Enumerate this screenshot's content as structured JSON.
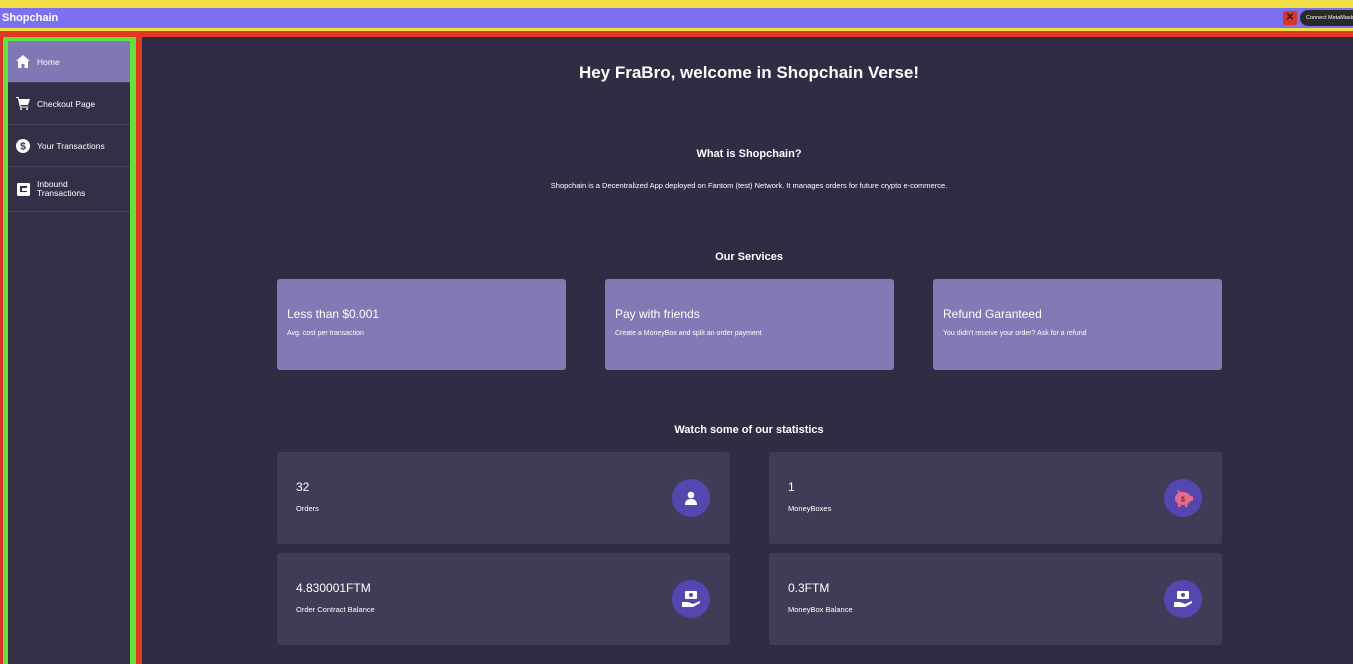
{
  "app_bar": {
    "title": "Shopchain",
    "close_label": "✕",
    "connect_label": "Connect MetaMask"
  },
  "sidebar": {
    "items": [
      {
        "label": "Home",
        "icon": "home-icon",
        "active": true
      },
      {
        "label": "Checkout Page",
        "icon": "cart-icon",
        "active": false
      },
      {
        "label": "Your Transactions",
        "icon": "dollar-icon",
        "active": false
      },
      {
        "label": "Inbound Transactions",
        "icon": "inbound-icon",
        "active": false
      }
    ]
  },
  "main": {
    "welcome": "Hey FraBro, welcome in Shopchain Verse!",
    "what_title": "What is Shopchain?",
    "what_desc": "Shopchain is a Decentralized App deployed on Fantom (test) Network. It manages orders for future crypto e-commerce.",
    "services_title": "Our Services",
    "services": [
      {
        "title": "Less than $0.001",
        "subtitle": "Avg. cost per transaction"
      },
      {
        "title": "Pay with friends",
        "subtitle": "Create a MoneyBox and split an order payment"
      },
      {
        "title": "Refund Garanteed",
        "subtitle": "You didn't receive your order? Ask for a refund"
      }
    ],
    "stats_title": "Watch some of our statistics",
    "stats": [
      {
        "value": "32",
        "label": "Orders",
        "icon": "user-icon"
      },
      {
        "value": "1",
        "label": "MoneyBoxes",
        "icon": "piggy-bank-icon"
      },
      {
        "value": "4.830001FTM",
        "label": "Order Contract Balance",
        "icon": "cash-hand-icon"
      },
      {
        "value": "0.3FTM",
        "label": "MoneyBox Balance",
        "icon": "cash-hand-icon"
      }
    ]
  },
  "colors": {
    "accent": "#7c6ff0",
    "card_service": "#8279b5",
    "card_stat": "#403c58",
    "background": "#2f2c44"
  }
}
